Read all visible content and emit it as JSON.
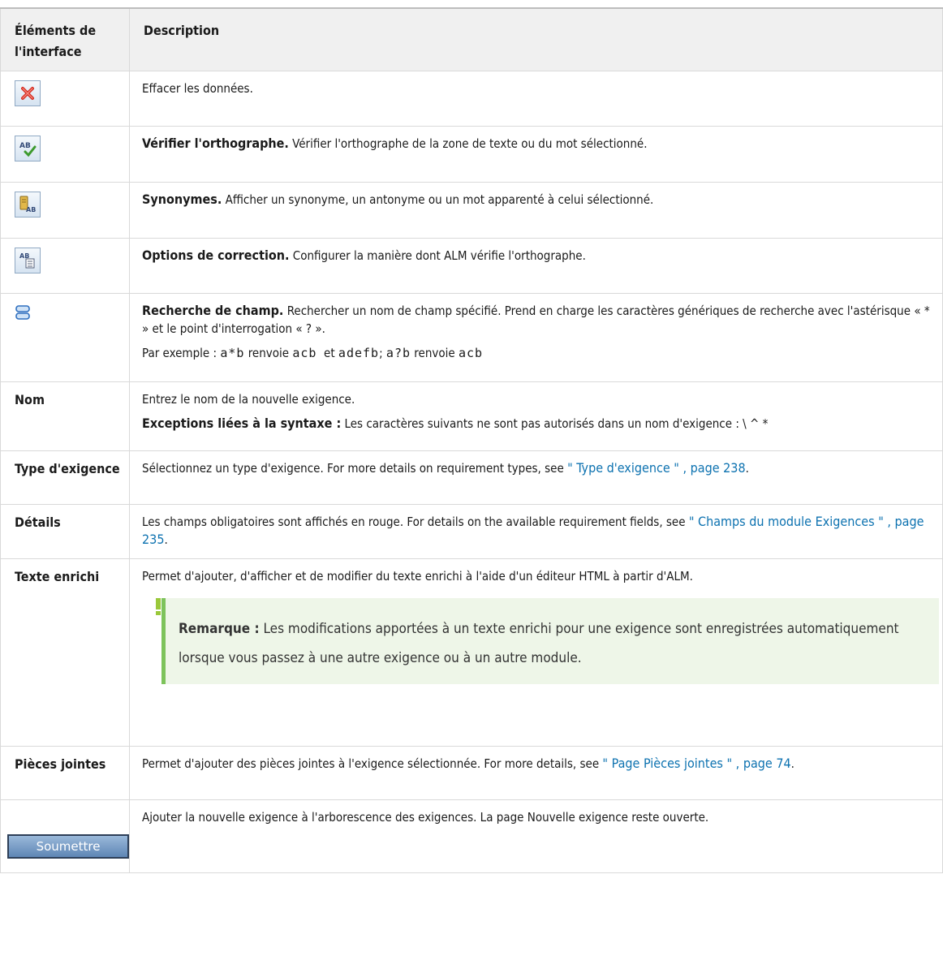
{
  "header": {
    "col1": "Éléments de l'interface",
    "col2": "Description"
  },
  "rows": {
    "clear": {
      "icon": "red-x-delete-icon",
      "desc": "Effacer les données."
    },
    "spell": {
      "icon": "spell-check-icon",
      "title": "Vérifier l'orthographe.",
      "desc": " Vérifier l'orthographe de la zone de texte ou du mot sélectionné."
    },
    "thesaurus": {
      "icon": "thesaurus-icon",
      "title": "Synonymes.",
      "desc": " Afficher un synonyme, un antonyme ou un mot apparenté à celui sélectionné."
    },
    "spell_options": {
      "icon": "spelling-options-icon",
      "title": "Options de correction.",
      "desc": " Configurer la manière dont ALM vérifie l'orthographe."
    },
    "field_search": {
      "icon": "field-search-icon",
      "title": "Recherche de champ.",
      "desc": " Rechercher un nom de champ spécifié. Prend en charge les caractères génériques de recherche avec l'astérisque « * » et le point d'interrogation « ? ».",
      "example_prefix": "Par exemple : ",
      "ex1": "a*b",
      "ex_renvoie1": " renvoie ",
      "ex2": "acb",
      "ex_et": "  et ",
      "ex3": "adefb",
      "ex_sep": "; ",
      "ex4": "a?b",
      "ex_renvoie2": " renvoie ",
      "ex5": "acb"
    },
    "name": {
      "label": "Nom",
      "desc": "Entrez le nom de la nouvelle exigence.",
      "exc_title": "Exceptions liées à la syntaxe :",
      "exc_desc": " Les caractères suivants ne sont pas autorisés dans un nom d'exigence : \\ ^ *"
    },
    "type": {
      "label": "Type d'exigence",
      "desc": "Sélectionnez un type d'exigence. For more details on requirement types, see ",
      "link": "\" Type d'exigence \" , page 238",
      "end": "."
    },
    "details": {
      "label": "Détails",
      "desc": "Les champs obligatoires sont affichés en rouge. For details on the available requirement fields, see ",
      "link": "\" Champs du module Exigences \" , page 235",
      "end": "."
    },
    "rich_text": {
      "label": "Texte enrichi",
      "desc": "Permet d'ajouter, d'afficher et de modifier du texte enrichi à l'aide d'un éditeur HTML à partir d'ALM.",
      "note_title": "Remarque :",
      "note_text": " Les modifications apportées à un texte enrichi pour une exigence sont enregistrées automatiquement lorsque vous passez à une autre exigence ou à un autre module."
    },
    "attachments": {
      "label": "Pièces jointes",
      "desc": "Permet d'ajouter des pièces jointes à l'exigence sélectionnée. For more details, see ",
      "link": "\" Page Pièces jointes \" , page 74",
      "end": "."
    },
    "submit": {
      "button": "Soumettre",
      "desc": "Ajouter la nouvelle exigence à l'arborescence des exigences. La page Nouvelle exigence reste ouverte."
    }
  }
}
